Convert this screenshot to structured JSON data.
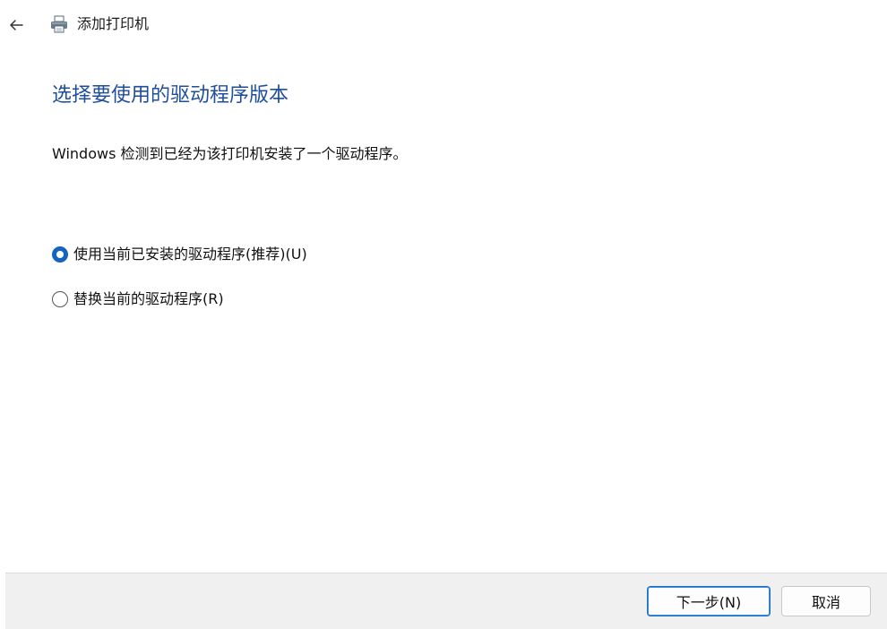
{
  "titlebar": {
    "back_icon": "arrow-left-icon",
    "app_icon": "printer-icon",
    "title": "添加打印机"
  },
  "main": {
    "heading": "选择要使用的驱动程序版本",
    "description": "Windows 检测到已经为该打印机安装了一个驱动程序。",
    "options": [
      {
        "label": "使用当前已安装的驱动程序(推荐)(U)",
        "selected": true
      },
      {
        "label": "替换当前的驱动程序(R)",
        "selected": false
      }
    ]
  },
  "footer": {
    "next_label": "下一步(N)",
    "cancel_label": "取消"
  },
  "colors": {
    "heading": "#1e4e9c",
    "radio_selected": "#1565c0",
    "footer_bg": "#f0f0f0",
    "primary_border": "#1a73c7"
  }
}
